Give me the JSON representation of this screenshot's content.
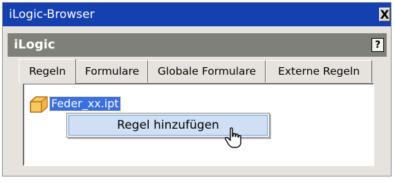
{
  "window": {
    "title": "iLogic-Browser",
    "close_label": "X"
  },
  "panel": {
    "title": "iLogic",
    "help_label": "?"
  },
  "tabs": [
    {
      "label": "Regeln",
      "active": true
    },
    {
      "label": "Formulare",
      "active": false
    },
    {
      "label": "Globale Formulare",
      "active": false
    },
    {
      "label": "Externe Regeln",
      "active": false
    }
  ],
  "tree": {
    "items": [
      {
        "label": "Feder_xx.ipt",
        "icon": "part-cube-icon"
      }
    ]
  },
  "context_menu": {
    "items": [
      {
        "label": "Regel hinzufügen"
      }
    ]
  },
  "colors": {
    "titlebar": "#1440b0",
    "panel_header": "#80807a",
    "selection": "#3a6fe0",
    "menu_highlight": "#cfe0f5",
    "window_bg": "#e6e3df"
  }
}
